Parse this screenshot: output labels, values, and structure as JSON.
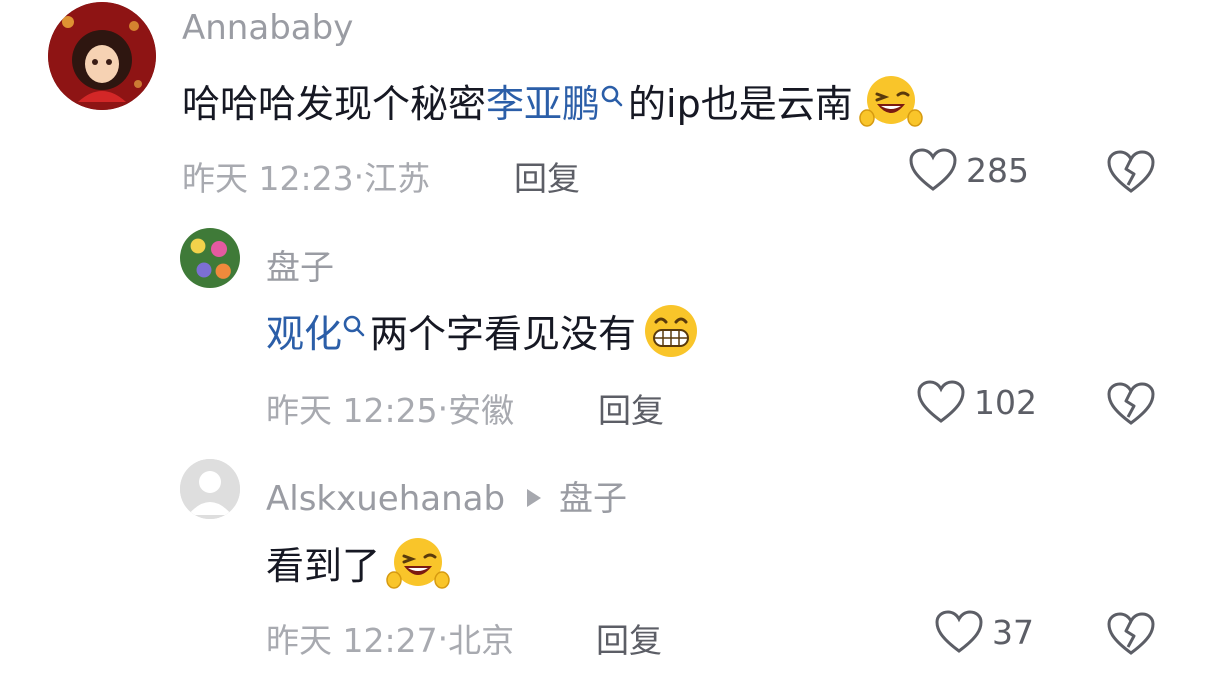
{
  "comments": [
    {
      "username": "Annababy",
      "text_plain": "哈哈哈发现个秘密 ",
      "text_link": "李亚鹏",
      "text_after": "的ip也是云南",
      "time": "昨天 12:23",
      "location": "江苏",
      "reply_label": "回复",
      "likes": "285"
    },
    {
      "username": "盘子",
      "text_link": "观化",
      "text_after": "两个字看见没有",
      "time": "昨天 12:25",
      "location": "安徽",
      "reply_label": "回复",
      "likes": "102"
    },
    {
      "username": "Alskxuehanab",
      "reply_to": "盘子",
      "text_plain": "看到了",
      "time": "昨天 12:27",
      "location": "北京",
      "reply_label": "回复",
      "likes": "37"
    }
  ],
  "separator": "·",
  "icons": {
    "like": "heart-outline-icon",
    "dislike": "broken-heart-icon",
    "search": "search-mini-icon",
    "emoji_wink": "laughing-wink-emoji-icon",
    "emoji_grin": "grinning-emoji-icon"
  }
}
